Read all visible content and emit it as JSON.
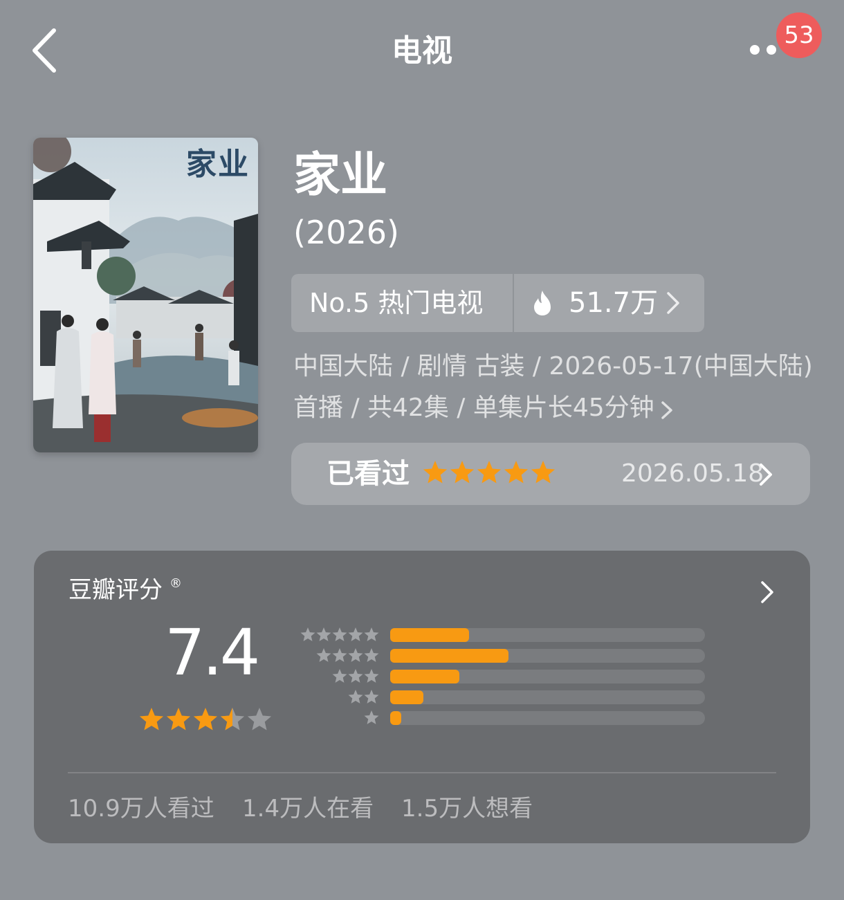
{
  "header": {
    "title": "电视",
    "notification_count": "53",
    "back_icon": "chevron-left-icon",
    "more_icon": "more-dots-icon"
  },
  "poster": {
    "title_text": "家业"
  },
  "show": {
    "name": "家业",
    "year": "(2026)",
    "rank_label": "No.5 热门电视",
    "heat_value": "51.7万",
    "heat_icon": "flame-icon",
    "meta_line1": "中国大陆 / 剧情 古装 / 2026-05-17(中国大陆)",
    "meta_line2": "首播 / 共42集 / 单集片长45分钟"
  },
  "watched": {
    "label": "已看过",
    "my_rating_stars": 5,
    "date": "2026.05.18"
  },
  "douban_rating": {
    "title": "豆瓣评分",
    "registered_mark": "®",
    "score": "7.4",
    "score_stars": 3.5,
    "distribution": [
      {
        "stars": 5,
        "fraction": 0.25
      },
      {
        "stars": 4,
        "fraction": 0.375
      },
      {
        "stars": 3,
        "fraction": 0.22
      },
      {
        "stars": 2,
        "fraction": 0.105
      },
      {
        "stars": 1,
        "fraction": 0.035
      }
    ],
    "stats": {
      "watched": "10.9万人看过",
      "watching": "1.4万人在看",
      "want": "1.5万人想看"
    }
  },
  "colors": {
    "background": "#8f9398",
    "card": "#6a6c6f",
    "accent_orange": "#f89a12",
    "badge_red": "#ee5c5c"
  }
}
